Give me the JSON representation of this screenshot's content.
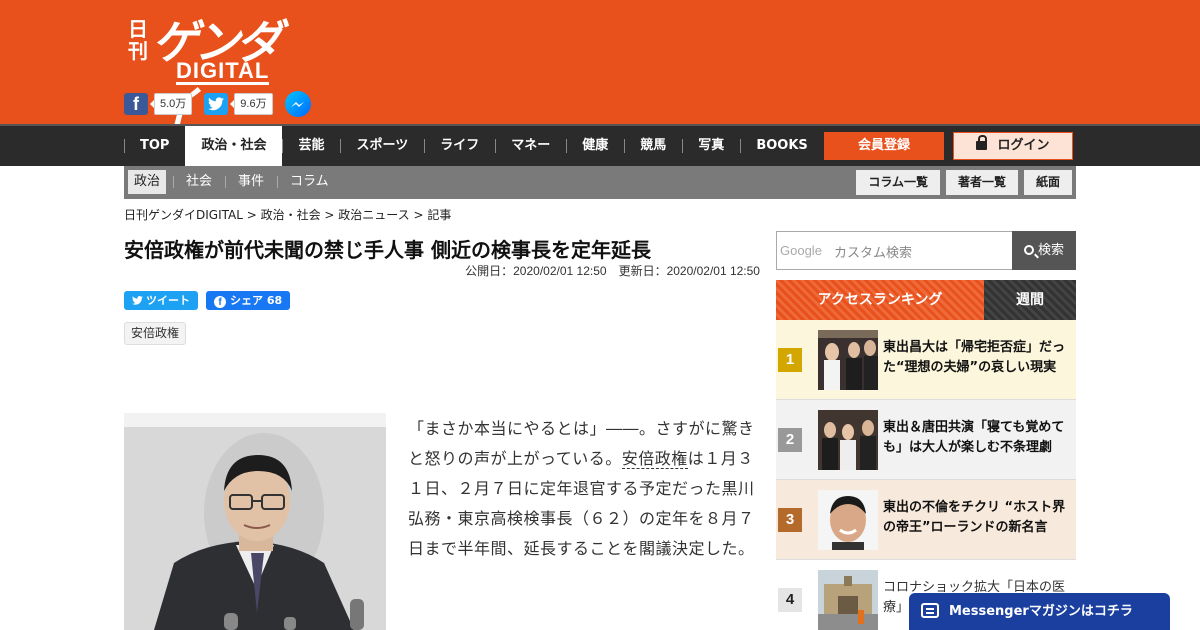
{
  "header": {
    "logo_small": "日刊",
    "logo_main": "ゲンダイ",
    "logo_sub": "DIGITAL",
    "facebook_count": "5.0万",
    "twitter_count": "9.6万",
    "brand_color": "#e8501c"
  },
  "nav": {
    "items": [
      "TOP",
      "政治・社会",
      "芸能",
      "スポーツ",
      "ライフ",
      "マネー",
      "健康",
      "競馬",
      "写真",
      "BOOKS"
    ],
    "active": "政治・社会",
    "register_label": "会員登録",
    "login_label": "ログイン"
  },
  "subnav": {
    "items": [
      "政治",
      "社会",
      "事件",
      "コラム"
    ],
    "active": "政治",
    "buttons": [
      "コラム一覧",
      "著者一覧",
      "紙面"
    ]
  },
  "breadcrumb": "日刊ゲンダイDIGITAL > 政治・社会 > 政治ニュース > 記事",
  "article": {
    "title": "安倍政権が前代未聞の禁じ手人事 側近の検事長を定年延長",
    "published": "公開日：2020/02/01 12:50",
    "updated": "更新日：2020/02/01 12:50",
    "tweet_label": "ツイート",
    "share_label": "シェア 68",
    "tag": "安倍政権",
    "body_1": "「まさか本当にやるとは」――。さすがに驚きと怒りの声が上がっている。",
    "body_link": "安倍政権",
    "body_2": "は１月３１日、２月７日に定年退官する予定だった黒川弘務・東京高検検事長（６２）の定年を８月７日まで半年間、延長することを閣議決定した。"
  },
  "sidebar": {
    "search_brand": "Google",
    "search_placeholder": "カスタム検索",
    "search_button": "検索",
    "tab_access": "アクセスランキング",
    "tab_weekly": "週間",
    "ranking": [
      {
        "rank": "1",
        "title": "東出昌大は「帰宅拒否症」だった“理想の夫婦”の哀しい現実",
        "color": "#d4a600",
        "bg": "#fbf6dc"
      },
      {
        "rank": "2",
        "title": "東出＆唐田共演「寝ても覚めても」は大人が楽しむ不条理劇",
        "color": "#999999",
        "bg": "#f2f2f2"
      },
      {
        "rank": "3",
        "title": "東出の不倫をチクリ “ホスト界の帝王”ローランドの新名言",
        "color": "#b36a2a",
        "bg": "#f7eadc"
      },
      {
        "rank": "4",
        "title": "コロナショック拡大「日本の医療」",
        "color": "#e5e5e5",
        "bg": "#ffffff"
      }
    ]
  },
  "messenger_label": "Messengerマガジンはコチラ"
}
